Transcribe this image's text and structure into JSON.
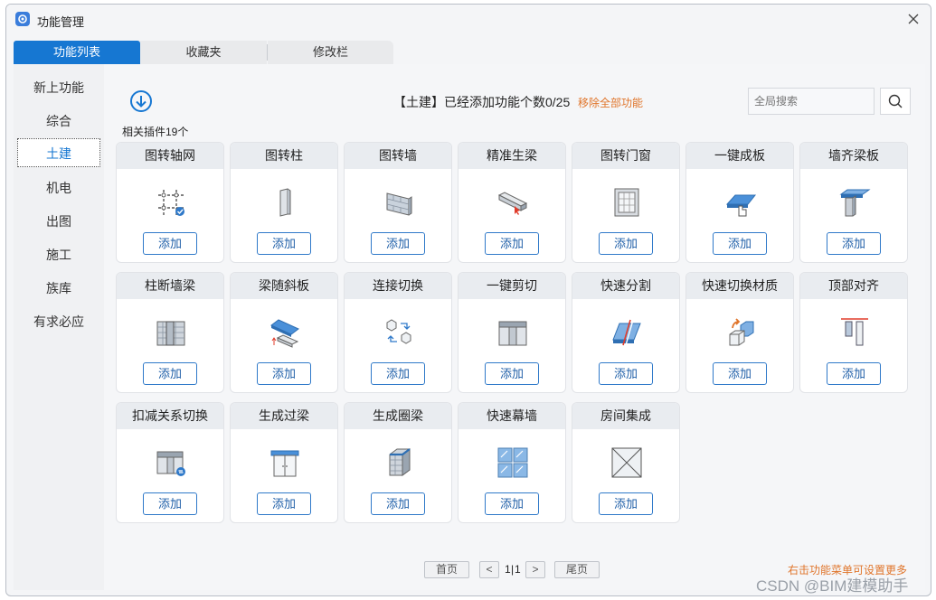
{
  "window": {
    "title": "功能管理"
  },
  "tabs": [
    {
      "label": "功能列表",
      "active": true
    },
    {
      "label": "收藏夹",
      "active": false
    },
    {
      "label": "修改栏",
      "active": false
    }
  ],
  "sidebar": {
    "items": [
      {
        "label": "新上功能",
        "active": false
      },
      {
        "label": "综合",
        "active": false
      },
      {
        "label": "土建",
        "active": true
      },
      {
        "label": "机电",
        "active": false
      },
      {
        "label": "出图",
        "active": false
      },
      {
        "label": "施工",
        "active": false
      },
      {
        "label": "族库",
        "active": false
      },
      {
        "label": "有求必应",
        "active": false
      }
    ]
  },
  "header": {
    "status": "【土建】已经添加功能个数0/25",
    "remove_all": "移除全部功能",
    "search_placeholder": "全局搜索",
    "plugin_count": "相关插件19个"
  },
  "cards": [
    {
      "title": "图转轴网",
      "icon": "grid-axis-icon",
      "button": "添加"
    },
    {
      "title": "图转柱",
      "icon": "column-icon",
      "button": "添加"
    },
    {
      "title": "图转墙",
      "icon": "wall-icon",
      "button": "添加"
    },
    {
      "title": "精准生梁",
      "icon": "beam-icon",
      "button": "添加"
    },
    {
      "title": "图转门窗",
      "icon": "window-icon",
      "button": "添加"
    },
    {
      "title": "一键成板",
      "icon": "slab-icon",
      "button": "添加"
    },
    {
      "title": "墙齐梁板",
      "icon": "wall-align-beam-icon",
      "button": "添加"
    },
    {
      "title": "柱断墙梁",
      "icon": "column-break-wall-icon",
      "button": "添加"
    },
    {
      "title": "梁随斜板",
      "icon": "beam-follow-slab-icon",
      "button": "添加"
    },
    {
      "title": "连接切换",
      "icon": "join-switch-icon",
      "button": "添加"
    },
    {
      "title": "一键剪切",
      "icon": "cut-icon",
      "button": "添加"
    },
    {
      "title": "快速分割",
      "icon": "split-icon",
      "button": "添加"
    },
    {
      "title": "快速切换材质",
      "icon": "material-switch-icon",
      "button": "添加"
    },
    {
      "title": "顶部对齐",
      "icon": "top-align-icon",
      "button": "添加"
    },
    {
      "title": "扣减关系切换",
      "icon": "deduct-switch-icon",
      "button": "添加"
    },
    {
      "title": "生成过梁",
      "icon": "lintel-icon",
      "button": "添加"
    },
    {
      "title": "生成圈梁",
      "icon": "ring-beam-icon",
      "button": "添加"
    },
    {
      "title": "快速幕墙",
      "icon": "curtain-wall-icon",
      "button": "添加"
    },
    {
      "title": "房间集成",
      "icon": "room-icon",
      "button": "添加"
    }
  ],
  "pager": {
    "first": "首页",
    "prev": "<",
    "current": "1",
    "separator": "|",
    "total": "1",
    "next": ">",
    "last": "尾页"
  },
  "hint": "右击功能菜单可设置更多",
  "watermark": "CSDN @BIM建模助手",
  "colors": {
    "accent": "#1677d2",
    "warning": "#e0752b"
  }
}
